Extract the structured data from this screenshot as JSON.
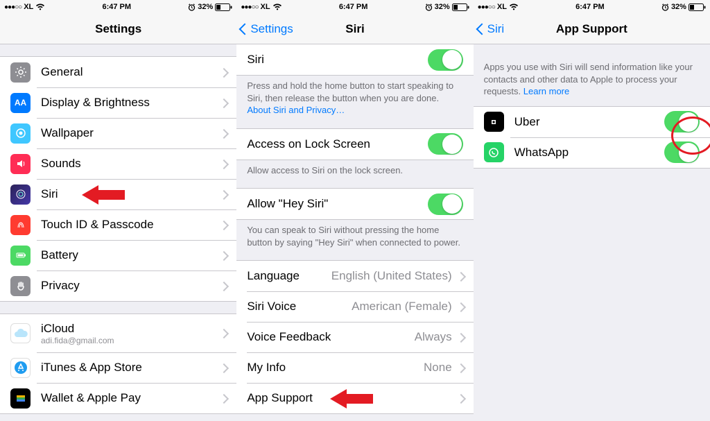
{
  "status": {
    "signal_dots": "●●●○○",
    "carrier": "XL",
    "time": "6:47 PM",
    "battery_pct": "32%"
  },
  "screen1": {
    "title": "Settings",
    "groupA": [
      {
        "label": "General"
      },
      {
        "label": "Display & Brightness"
      },
      {
        "label": "Wallpaper"
      },
      {
        "label": "Sounds"
      },
      {
        "label": "Siri"
      },
      {
        "label": "Touch ID & Passcode"
      },
      {
        "label": "Battery"
      },
      {
        "label": "Privacy"
      }
    ],
    "groupB": [
      {
        "label": "iCloud",
        "sub": "adi.fida@gmail.com"
      },
      {
        "label": "iTunes & App Store"
      },
      {
        "label": "Wallet & Apple Pay"
      }
    ]
  },
  "screen2": {
    "back": "Settings",
    "title": "Siri",
    "row_siri": "Siri",
    "footer1_a": "Press and hold the home button to start speaking to Siri, then release the button when you are done. ",
    "footer1_link": "About Siri and Privacy…",
    "row_lock": "Access on Lock Screen",
    "footer2": "Allow access to Siri on the lock screen.",
    "row_hey": "Allow \"Hey Siri\"",
    "footer3": "You can speak to Siri without pressing the home button by saying \"Hey Siri\" when connected to power.",
    "rows_detail": [
      {
        "label": "Language",
        "value": "English (United States)"
      },
      {
        "label": "Siri Voice",
        "value": "American (Female)"
      },
      {
        "label": "Voice Feedback",
        "value": "Always"
      },
      {
        "label": "My Info",
        "value": "None"
      },
      {
        "label": "App Support",
        "value": ""
      }
    ]
  },
  "screen3": {
    "back": "Siri",
    "title": "App Support",
    "footer_a": "Apps you use with Siri will send information like your contacts and other data to Apple to process your requests. ",
    "footer_link": "Learn more",
    "apps": [
      {
        "label": "Uber"
      },
      {
        "label": "WhatsApp"
      }
    ]
  }
}
